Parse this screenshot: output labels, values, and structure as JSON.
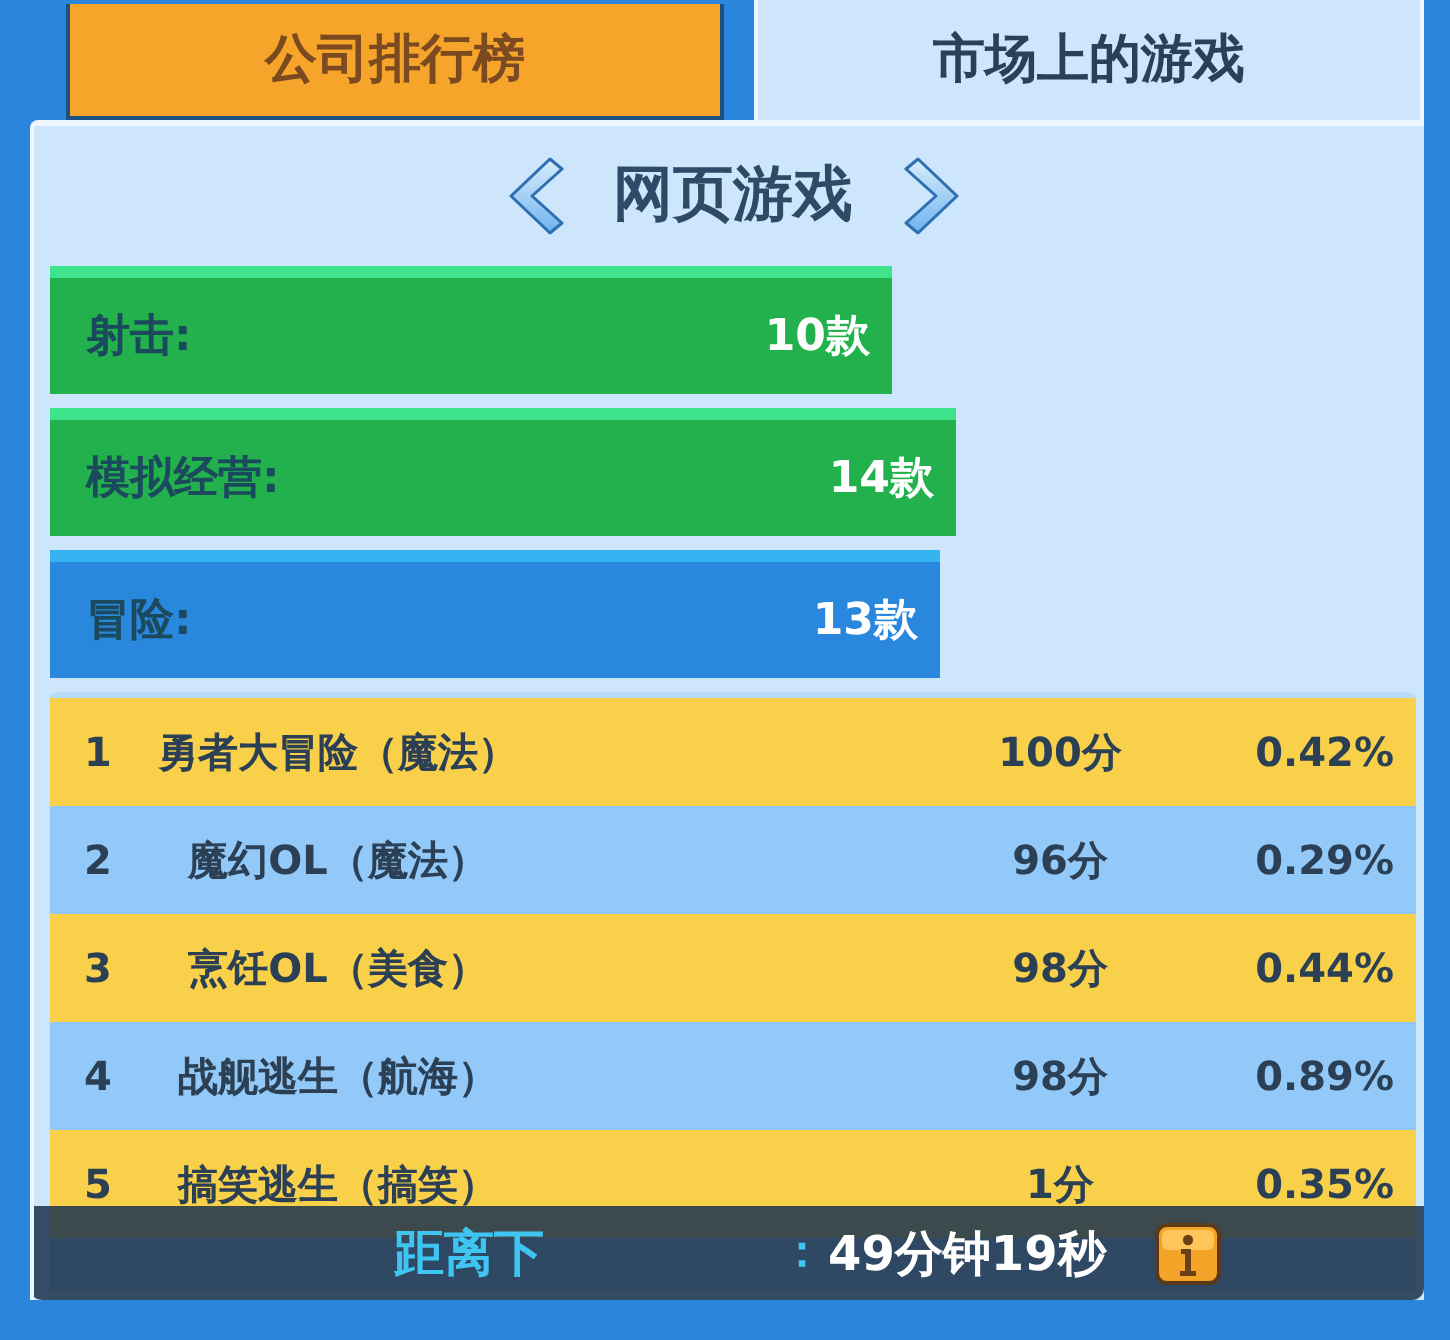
{
  "tabs": [
    {
      "label": "公司排行榜",
      "selected": false
    },
    {
      "label": "市场上的游戏",
      "selected": true
    }
  ],
  "category_nav": {
    "title": "网页游戏"
  },
  "genres": [
    {
      "label": "射击:",
      "count": "10款",
      "selected": false
    },
    {
      "label": "模拟经营:",
      "count": "14款",
      "selected": false
    },
    {
      "label": "冒险:",
      "count": "13款",
      "selected": true
    }
  ],
  "games": [
    {
      "rank": "1",
      "name": "勇者大冒险（魔法）",
      "score": "100分",
      "share": "0.42%"
    },
    {
      "rank": "2",
      "name": "魔幻OL（魔法）",
      "score": "96分",
      "share": "0.29%"
    },
    {
      "rank": "3",
      "name": "烹饪OL（美食）",
      "score": "98分",
      "share": "0.44%"
    },
    {
      "rank": "4",
      "name": "战舰逃生（航海）",
      "score": "98分",
      "share": "0.89%"
    },
    {
      "rank": "5",
      "name": "搞笑逃生（搞笑）",
      "score": "1分",
      "share": "0.35%"
    }
  ],
  "countdown": {
    "label": "距离下",
    "separator": "：",
    "time": "49分钟19秒"
  }
}
